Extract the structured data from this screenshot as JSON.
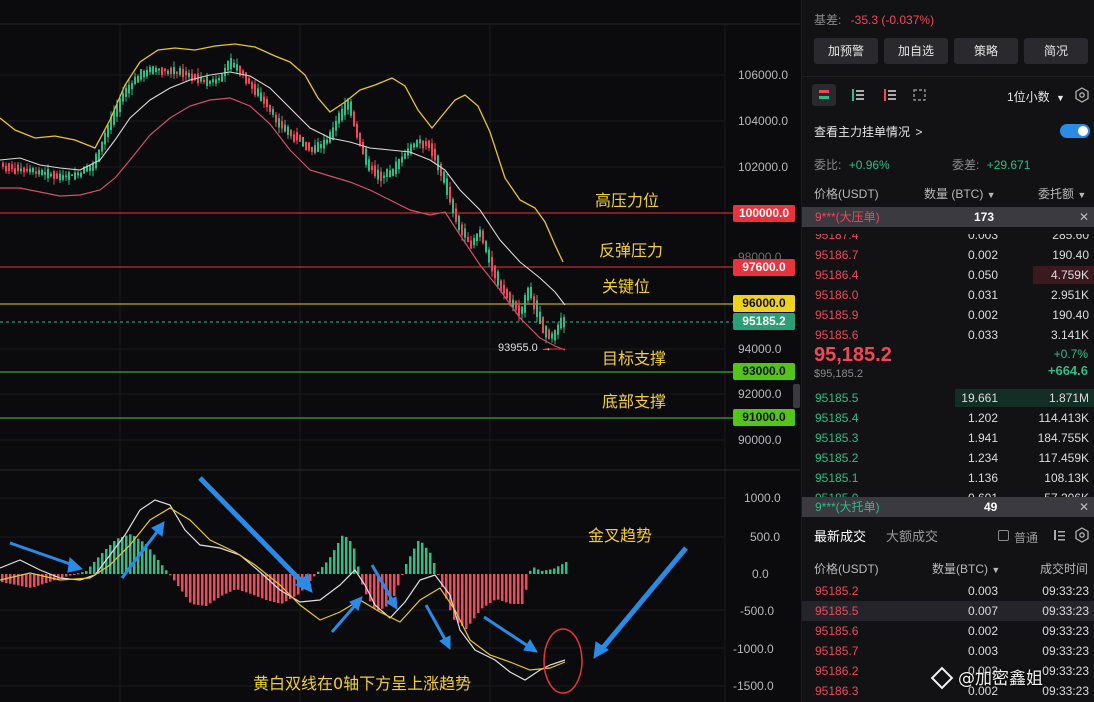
{
  "chart": {
    "price_axis": [
      "106000.0",
      "104000.0",
      "102000.0",
      "98000.0",
      "94000.0",
      "92000.0",
      "90000.0"
    ],
    "macd_axis": [
      "1000.0",
      "500.0",
      "0.0",
      "-500.0",
      "-1000.0",
      "-1500.0"
    ],
    "levels": {
      "l100000": "100000.0",
      "l97600": "97600.0",
      "l96000": "96000.0",
      "l95185": "95185.2",
      "l93000": "93000.0",
      "l91000": "91000.0"
    },
    "low_marker": "93955.0 →",
    "annotations": {
      "high_resistance": "高压力位",
      "rebound_resistance": "反弹压力",
      "key_level": "关键位",
      "target_support": "目标支撑",
      "bottom_support": "底部支撑",
      "golden_cross": "金叉趋势",
      "macd_note": "黄白双线在0轴下方呈上涨趋势"
    },
    "watermark": "@加密鑫姐"
  },
  "panel": {
    "basis_label": "基差:",
    "basis_value": "-35.3 (-0.037%)",
    "buttons": [
      "加预警",
      "加自选",
      "策略",
      "简况"
    ],
    "precision": "1位小数",
    "main_orders": "查看主力挂单情况",
    "commission_ratio_label": "委比:",
    "commission_ratio": "+0.96%",
    "commission_diff_label": "委差:",
    "commission_diff": "+29.671",
    "ob_headers": [
      "价格(USDT)",
      "数量 (BTC)",
      "委托额"
    ],
    "big_ask": {
      "label": "9***(大压单)",
      "value": "173"
    },
    "asks": [
      {
        "p": "95187.4",
        "q": "0.003",
        "t": "285.60"
      },
      {
        "p": "95186.7",
        "q": "0.002",
        "t": "190.40"
      },
      {
        "p": "95186.4",
        "q": "0.050",
        "t": "4.759K"
      },
      {
        "p": "95186.0",
        "q": "0.031",
        "t": "2.951K"
      },
      {
        "p": "95185.9",
        "q": "0.002",
        "t": "190.40"
      },
      {
        "p": "95185.6",
        "q": "0.033",
        "t": "3.141K"
      }
    ],
    "last_price": "95,185.2",
    "last_price_sub": "$95,185.2",
    "change_pct": "+0.7%",
    "change_abs": "+664.6",
    "bids": [
      {
        "p": "95185.5",
        "q": "19.661",
        "t": "1.871M"
      },
      {
        "p": "95185.4",
        "q": "1.202",
        "t": "114.413K"
      },
      {
        "p": "95185.3",
        "q": "1.941",
        "t": "184.755K"
      },
      {
        "p": "95185.2",
        "q": "1.234",
        "t": "117.459K"
      },
      {
        "p": "95185.1",
        "q": "1.136",
        "t": "108.13K"
      },
      {
        "p": "95185.0",
        "q": "0.601",
        "t": "57.206K"
      }
    ],
    "big_bid": {
      "label": "9***(大托单)",
      "value": "49"
    },
    "trade_tabs": [
      "最新成交",
      "大额成交"
    ],
    "normal_label": "普通",
    "trade_headers": [
      "价格(USDT)",
      "数量(BTC)",
      "成交时间"
    ],
    "trades": [
      {
        "p": "95185.2",
        "q": "0.003",
        "t": "09:33:23",
        "c": "red"
      },
      {
        "p": "95185.5",
        "q": "0.007",
        "t": "09:33:23",
        "c": "red"
      },
      {
        "p": "95185.6",
        "q": "0.002",
        "t": "09:33:23",
        "c": "red"
      },
      {
        "p": "95185.7",
        "q": "0.003",
        "t": "09:33:23",
        "c": "red"
      },
      {
        "p": "95186.2",
        "q": "0.003",
        "t": "09:33:23",
        "c": "red"
      },
      {
        "p": "95186.3",
        "q": "0.002",
        "t": "09:33:23",
        "c": "red"
      }
    ]
  }
}
